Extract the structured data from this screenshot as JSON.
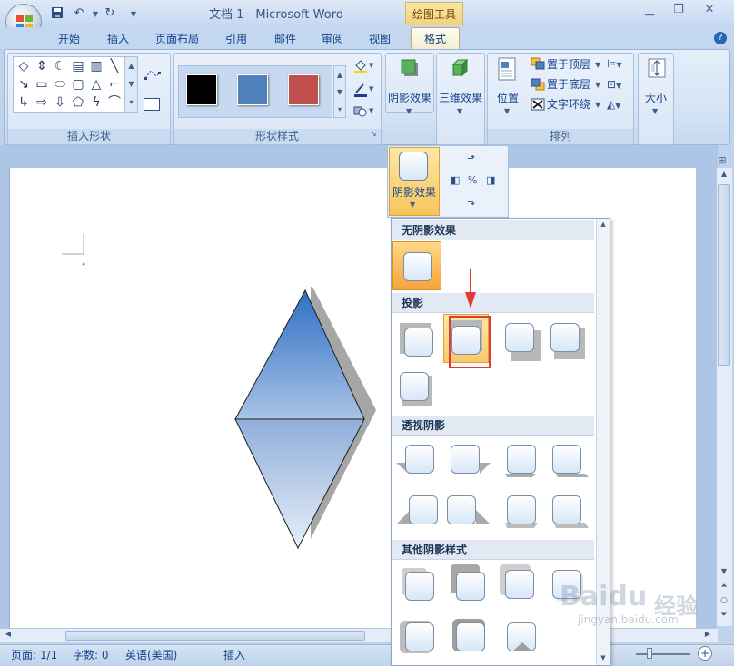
{
  "window": {
    "title": "文档 1 - Microsoft Word",
    "context_group": "绘图工具",
    "help": "?"
  },
  "tabs": [
    "开始",
    "插入",
    "页面布局",
    "引用",
    "邮件",
    "审阅",
    "视图",
    "格式"
  ],
  "ribbon": {
    "groups": {
      "insert_shapes": "插入形状",
      "shape_styles": "形状样式",
      "arrange": "排列"
    },
    "shadow_effects_label": "阴影效果",
    "effects_3d_label": "三维效果",
    "position_label": "位置",
    "bring_to_front": "置于顶层",
    "send_to_back": "置于底层",
    "text_wrapping": "文字环绕",
    "size_label": "大小",
    "style_swatches": [
      "#000000",
      "#4f81bd",
      "#c0504d"
    ]
  },
  "shadow_dropdown": {
    "label": "阴影效果",
    "sections": [
      "无阴影效果",
      "投影",
      "透视阴影",
      "其他阴影样式"
    ]
  },
  "status_bar": {
    "page": "页面: 1/1",
    "words": "字数: 0",
    "language": "英语(美国)",
    "mode": "插入"
  },
  "watermark": {
    "brand": "Baidu",
    "suffix": "经验",
    "url": "jingyan.baidu.com"
  },
  "colors": {
    "accent_blue": "#2b66b2",
    "highlight_red": "#e53935",
    "active_orange": "#f7c45a"
  }
}
